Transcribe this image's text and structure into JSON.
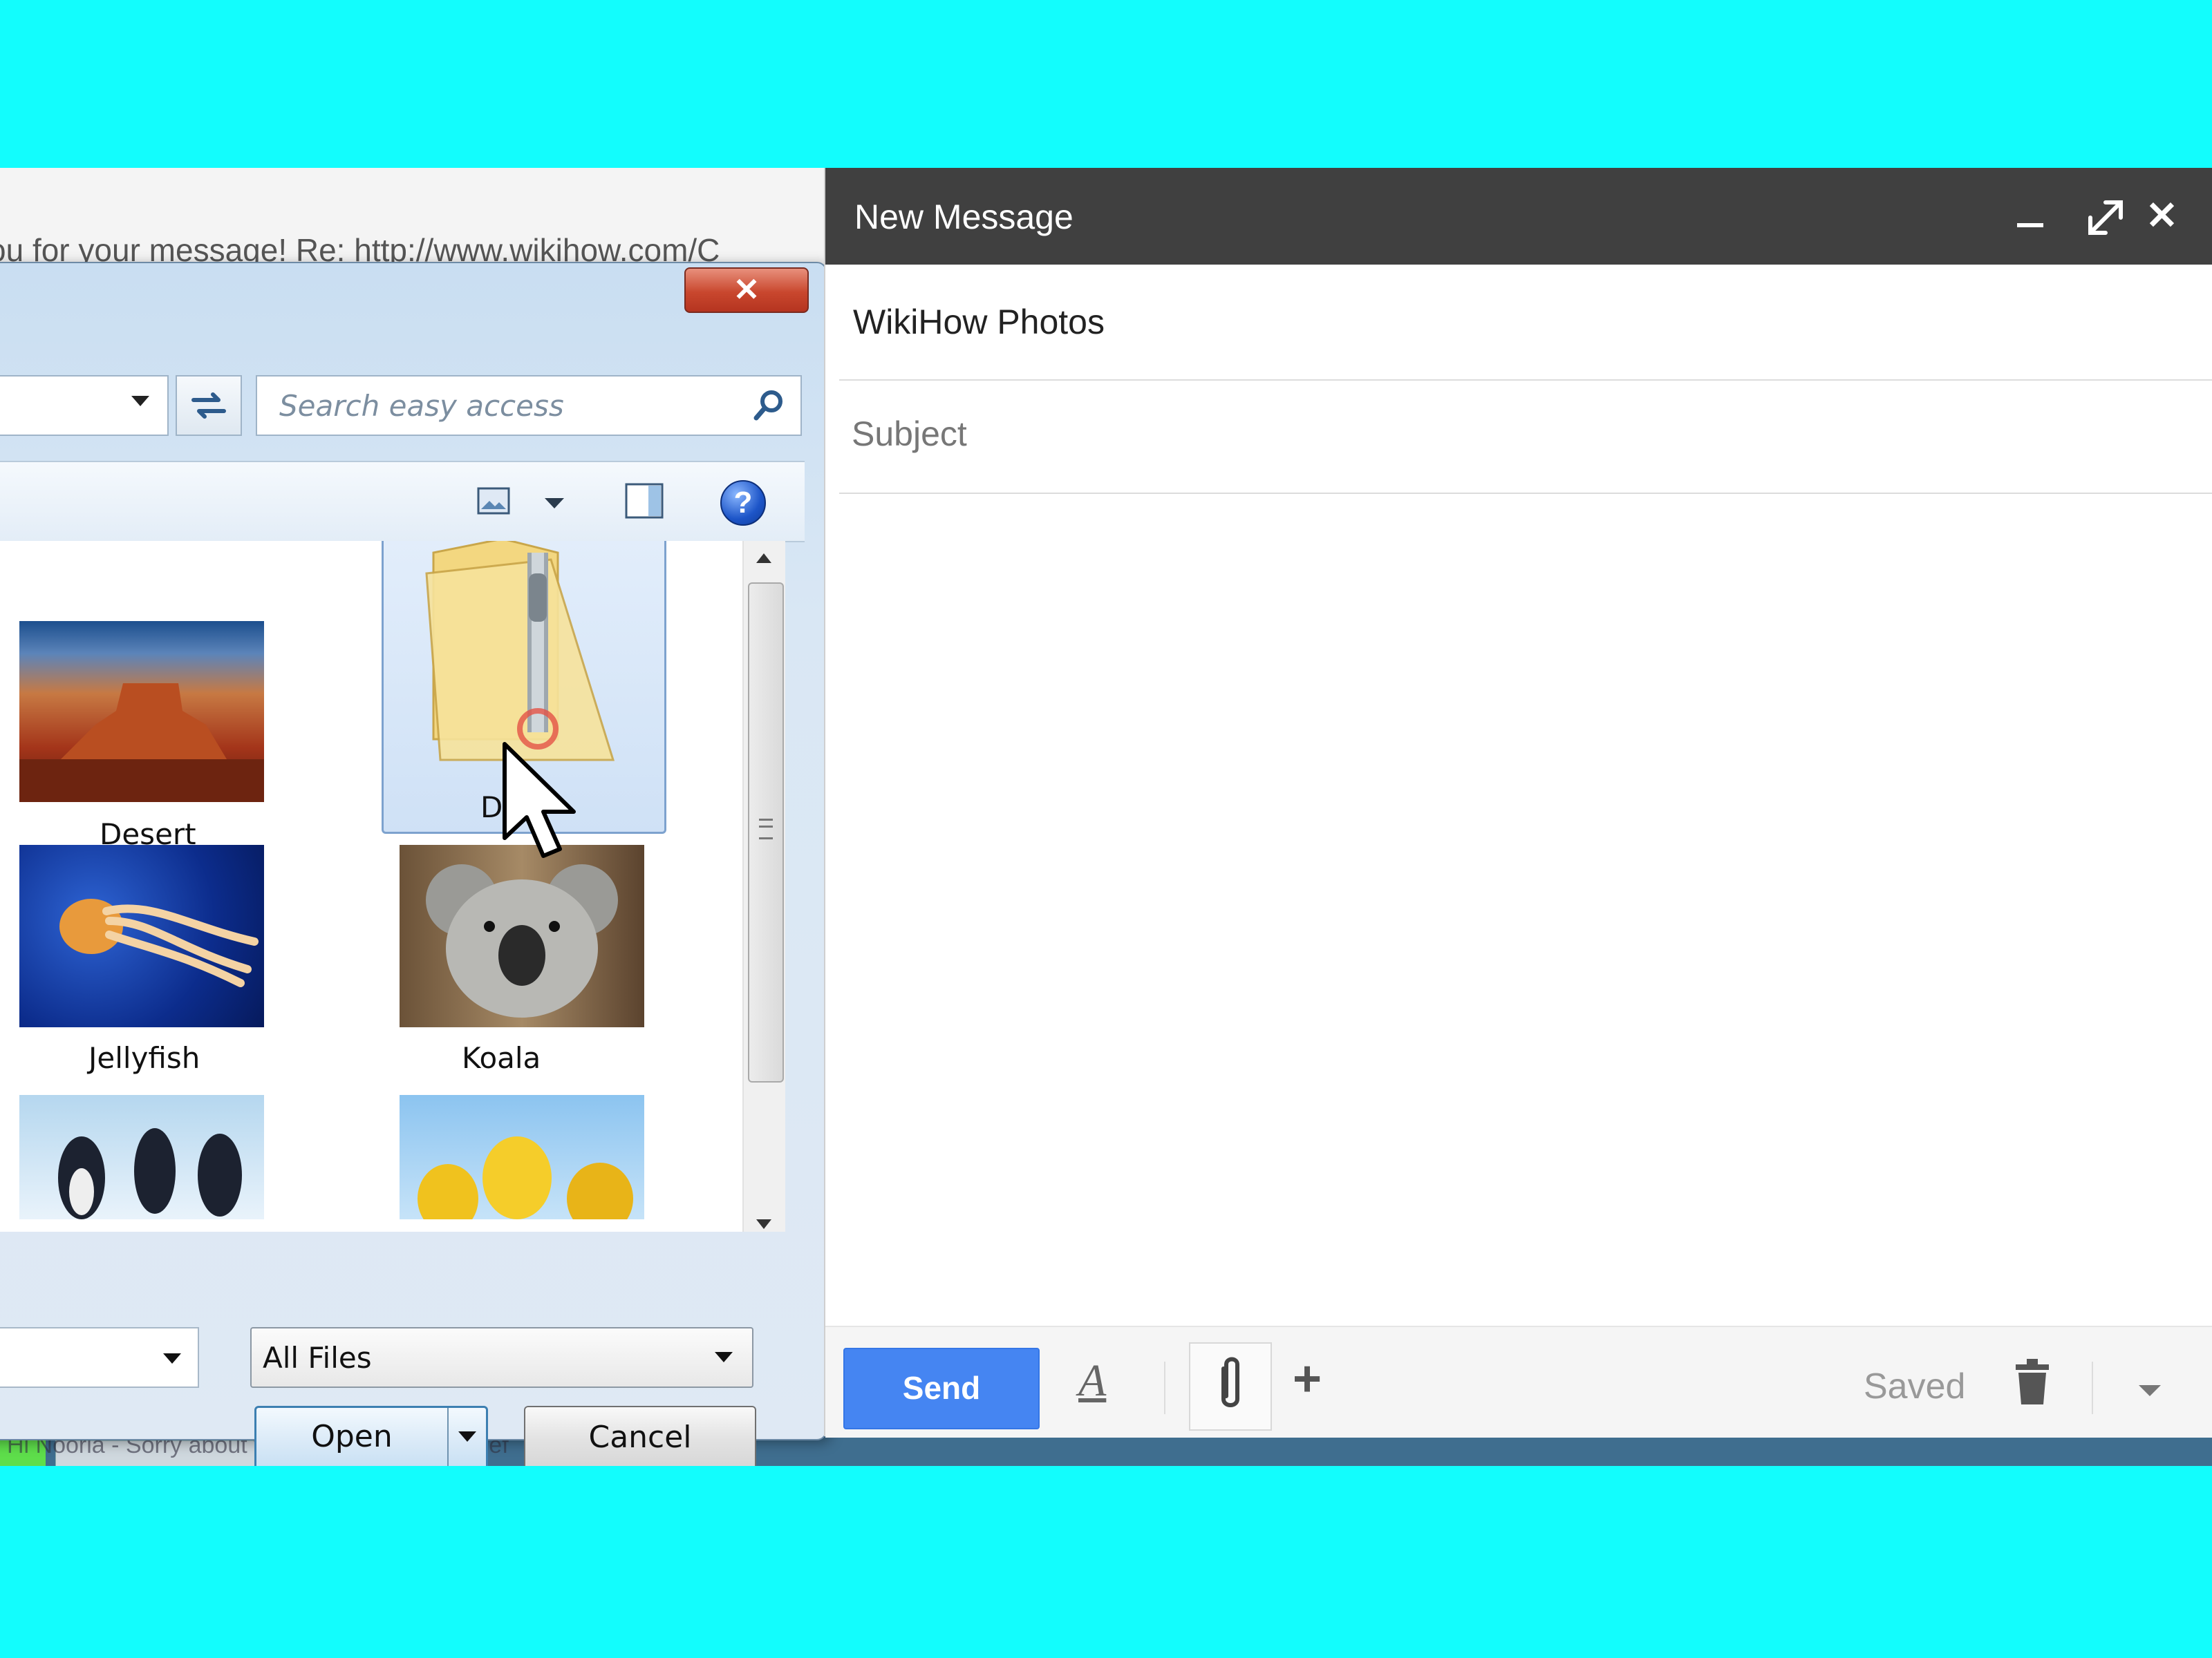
{
  "background": {
    "email_snippet": "you for your message! Re: http://www.wikihow.com/C",
    "taskbar_snippet": "Hi Nooria - Sorry about the delay! Here is a brief"
  },
  "dialog": {
    "close_label": "✕",
    "search": {
      "placeholder": "Search easy access"
    },
    "help_label": "?",
    "items": [
      {
        "label": "Desert",
        "type": "image"
      },
      {
        "label": "Des",
        "type": "zip-folder",
        "selected": true
      },
      {
        "label": "Jellyfish",
        "type": "image"
      },
      {
        "label": "Koala",
        "type": "image"
      },
      {
        "label": "",
        "type": "image"
      },
      {
        "label": "",
        "type": "image"
      }
    ],
    "file_type": "All Files",
    "open_label": "Open",
    "cancel_label": "Cancel"
  },
  "compose": {
    "title": "New Message",
    "to": "WikiHow Photos",
    "subject_placeholder": "Subject",
    "send_label": "Send",
    "format_label": "A",
    "more_label": "+",
    "status": "Saved",
    "colors": {
      "header": "#404040",
      "send": "#4585f2"
    }
  }
}
